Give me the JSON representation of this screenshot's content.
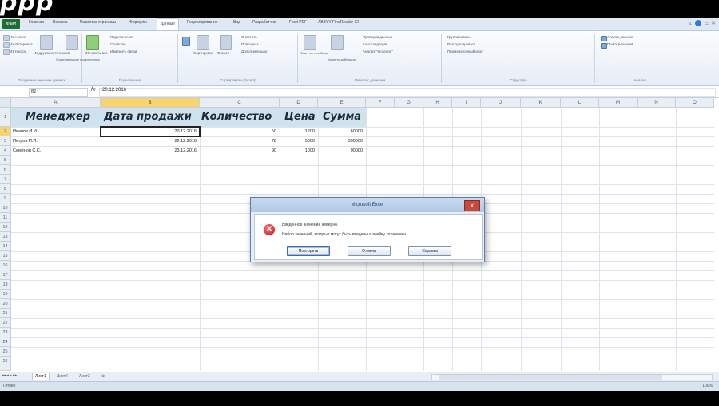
{
  "overlay": {
    "top_text": "ррр"
  },
  "ribbon": {
    "file_tab": "Файл",
    "tabs": [
      "Главная",
      "Вставка",
      "Разметка страницы",
      "Формулы",
      "Данные",
      "Рецензирование",
      "Вид",
      "Разработчик",
      "Foxit PDF",
      "ABBYY FineReader 12"
    ],
    "active_tab_index": 4,
    "groups": [
      {
        "label": "Получение внешних данных",
        "lines": [
          "Из Access",
          "Из Интернета",
          "Из текста",
          "Из других источников",
          "Существующие подключения"
        ]
      },
      {
        "label": "Подключения",
        "lines": [
          "Подключения",
          "Свойства",
          "Изменить связи",
          "Обновить все"
        ]
      },
      {
        "label": "Сортировка и фильтр",
        "lines": [
          "Сортировка",
          "Фильтр",
          "Очистить",
          "Повторить",
          "Дополнительно"
        ]
      },
      {
        "label": "Работа с данными",
        "lines": [
          "Текст по столбцам",
          "Удалить дубликаты",
          "Проверка данных",
          "Консолидация",
          "Анализ \"что если\""
        ]
      },
      {
        "label": "Структура",
        "lines": [
          "Группировать",
          "Разгруппировать",
          "Промежуточный итог"
        ]
      },
      {
        "label": "Анализ",
        "lines": [
          "Анализ данных",
          "Поиск решения"
        ]
      }
    ]
  },
  "formula_bar": {
    "cell_ref": "B2",
    "fx": "fx",
    "value": "20.12.2016"
  },
  "columns": [
    "A",
    "B",
    "C",
    "D",
    "E",
    "F",
    "G",
    "H",
    "I",
    "J",
    "K",
    "L",
    "M",
    "N",
    "O"
  ],
  "rows": [
    "1",
    "2",
    "3",
    "4",
    "5",
    "6",
    "7",
    "8",
    "9",
    "10",
    "11",
    "12",
    "13",
    "14",
    "15",
    "16",
    "17",
    "18",
    "19",
    "20",
    "21",
    "22",
    "23",
    "24",
    "25",
    "26"
  ],
  "table": {
    "headers": [
      "Менеджер",
      "Дата продажи",
      "Количество",
      "Цена",
      "Сумма"
    ],
    "data": [
      [
        "Иванов И.И.",
        "20.12.2016",
        "50",
        "1200",
        "60000"
      ],
      [
        "Петров П.П.",
        "22.12.2016",
        "78",
        "5000",
        "390000"
      ],
      [
        "Семёнов С.С.",
        "23.12.2016",
        "90",
        "1000",
        "90000"
      ]
    ]
  },
  "sheets": [
    "Лист1",
    "Лист2",
    "Лист3"
  ],
  "active_sheet": "Лист1",
  "status": {
    "mode": "Готово",
    "zoom": "100%"
  },
  "dialog": {
    "title": "Microsoft Excel",
    "line1": "Введенное значение неверно.",
    "line2": "Набор значений, которые могут быть введены в ячейку, ограничен.",
    "buttons": [
      "Повторить",
      "Отмена",
      "Справка"
    ],
    "close": "x"
  },
  "colors": {
    "accent_file": "#1d6e2f",
    "header_fill": "#cfe2ee",
    "error_red": "#c8161d"
  }
}
